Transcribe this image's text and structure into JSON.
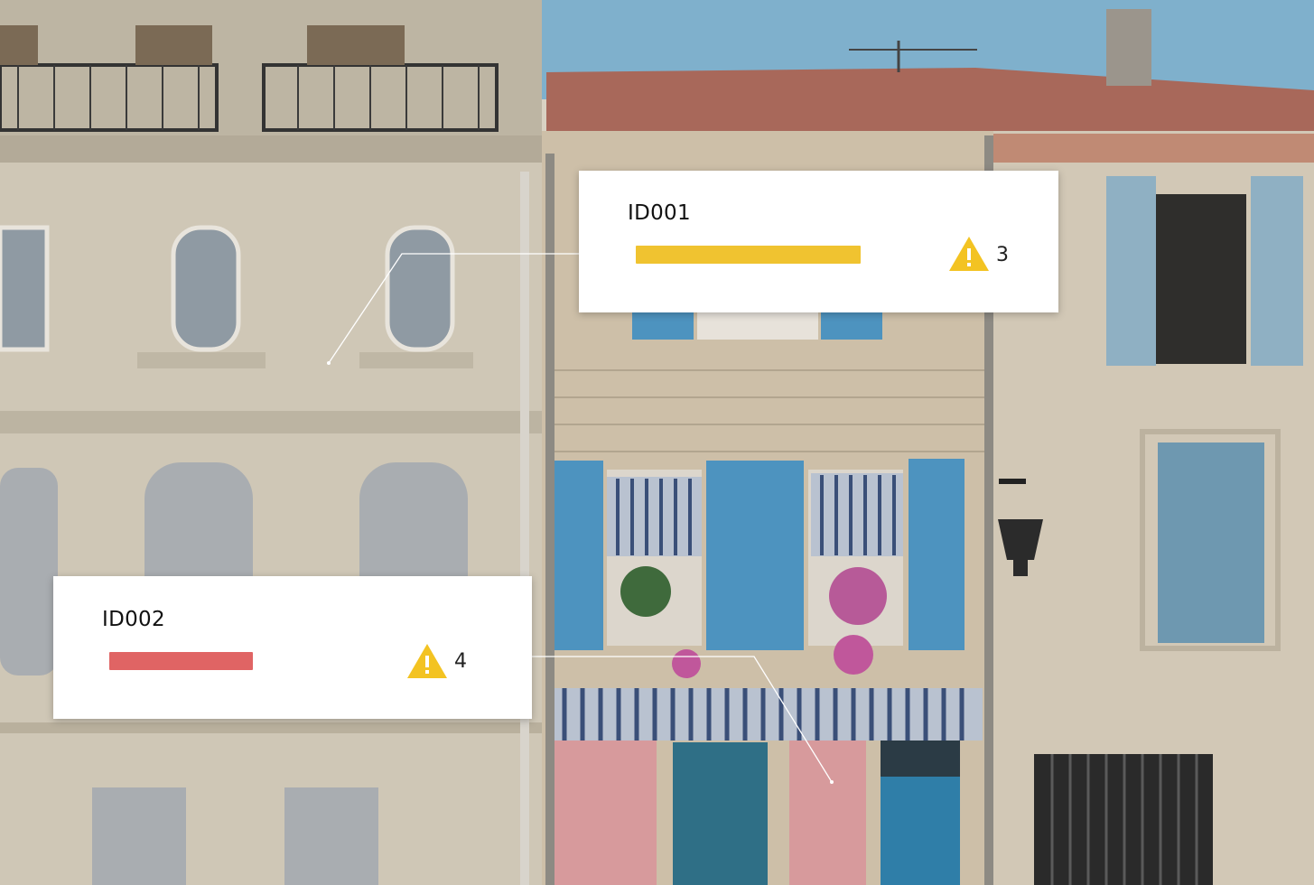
{
  "scene": {
    "description_icon": "building-facade-photo",
    "colors": {
      "sky": "#7fb0cc",
      "roof": "#a7665a",
      "stone": "#cfc6b4",
      "shutter_blue": "#4d93bf",
      "shutter_grey": "#a7adb3",
      "pink_wall": "#d79a9c"
    }
  },
  "cards": [
    {
      "id": "ID001",
      "count": "3",
      "bar_color": "#f0c330",
      "warning_color": "#f3c322",
      "icon": "warning-icon"
    },
    {
      "id": "ID002",
      "count": "4",
      "bar_color": "#e06464",
      "warning_color": "#f3c322",
      "icon": "warning-icon"
    }
  ]
}
